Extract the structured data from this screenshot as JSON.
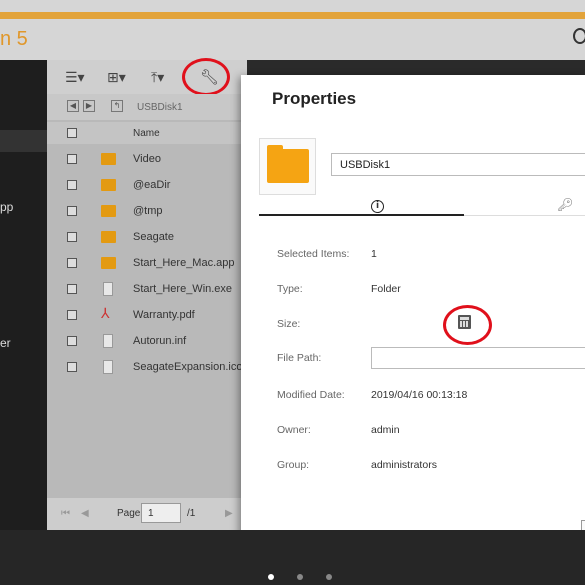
{
  "app": {
    "title": "n 5"
  },
  "sidebar": {
    "items": [
      {
        "label": "pp"
      },
      {
        "label": "er"
      }
    ]
  },
  "file_manager": {
    "breadcrumb": "USBDisk1",
    "column_header": "Name",
    "files": [
      {
        "name": "Video",
        "type": "folder"
      },
      {
        "name": "@eaDir",
        "type": "folder"
      },
      {
        "name": "@tmp",
        "type": "folder"
      },
      {
        "name": "Seagate",
        "type": "folder"
      },
      {
        "name": "Start_Here_Mac.app",
        "type": "folder"
      },
      {
        "name": "Start_Here_Win.exe",
        "type": "file"
      },
      {
        "name": "Warranty.pdf",
        "type": "pdf"
      },
      {
        "name": "Autorun.inf",
        "type": "file"
      },
      {
        "name": "SeagateExpansion.ico",
        "type": "file"
      }
    ],
    "pager": {
      "page_label": "Page",
      "page_value": "1",
      "total": "/1"
    }
  },
  "dialog": {
    "title": "Properties",
    "name_value": "USBDisk1",
    "fields": {
      "selected_items": {
        "label": "Selected Items:",
        "value": "1"
      },
      "type": {
        "label": "Type:",
        "value": "Folder"
      },
      "size": {
        "label": "Size:"
      },
      "file_path": {
        "label": "File Path:",
        "value": ""
      },
      "modified": {
        "label": "Modified Date:",
        "value": "2019/04/16 00:13:18"
      },
      "owner": {
        "label": "Owner:",
        "value": "admin"
      },
      "group": {
        "label": "Group:",
        "value": "administrators"
      }
    }
  },
  "colors": {
    "accent": "#e2a33a",
    "folder": "#f5a413",
    "highlight_circle": "#e0101b"
  }
}
